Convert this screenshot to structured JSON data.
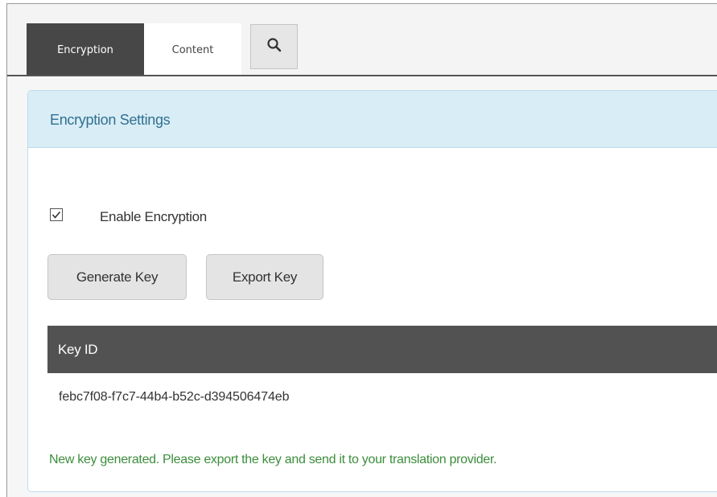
{
  "tabs": {
    "encryption_label": "Encryption",
    "content_label": "Content",
    "search_icon": "search-icon"
  },
  "panel": {
    "title": "Encryption Settings",
    "enable_encryption": {
      "label": "Enable Encryption",
      "checked": true
    },
    "buttons": {
      "generate_key": "Generate Key",
      "export_key": "Export Key"
    },
    "table": {
      "columns": [
        "Key ID"
      ],
      "rows": [
        [
          "febc7f08-f7c7-44b4-b52c-d394506474eb"
        ]
      ]
    },
    "status_message": "New key generated. Please export the key and send it to your translation provider."
  },
  "colors": {
    "active_tab": "#474747",
    "panel_header_bg": "#d9edf7",
    "panel_title": "#31708f",
    "table_header_bg": "#525252",
    "success_text": "#3c8d3c"
  }
}
